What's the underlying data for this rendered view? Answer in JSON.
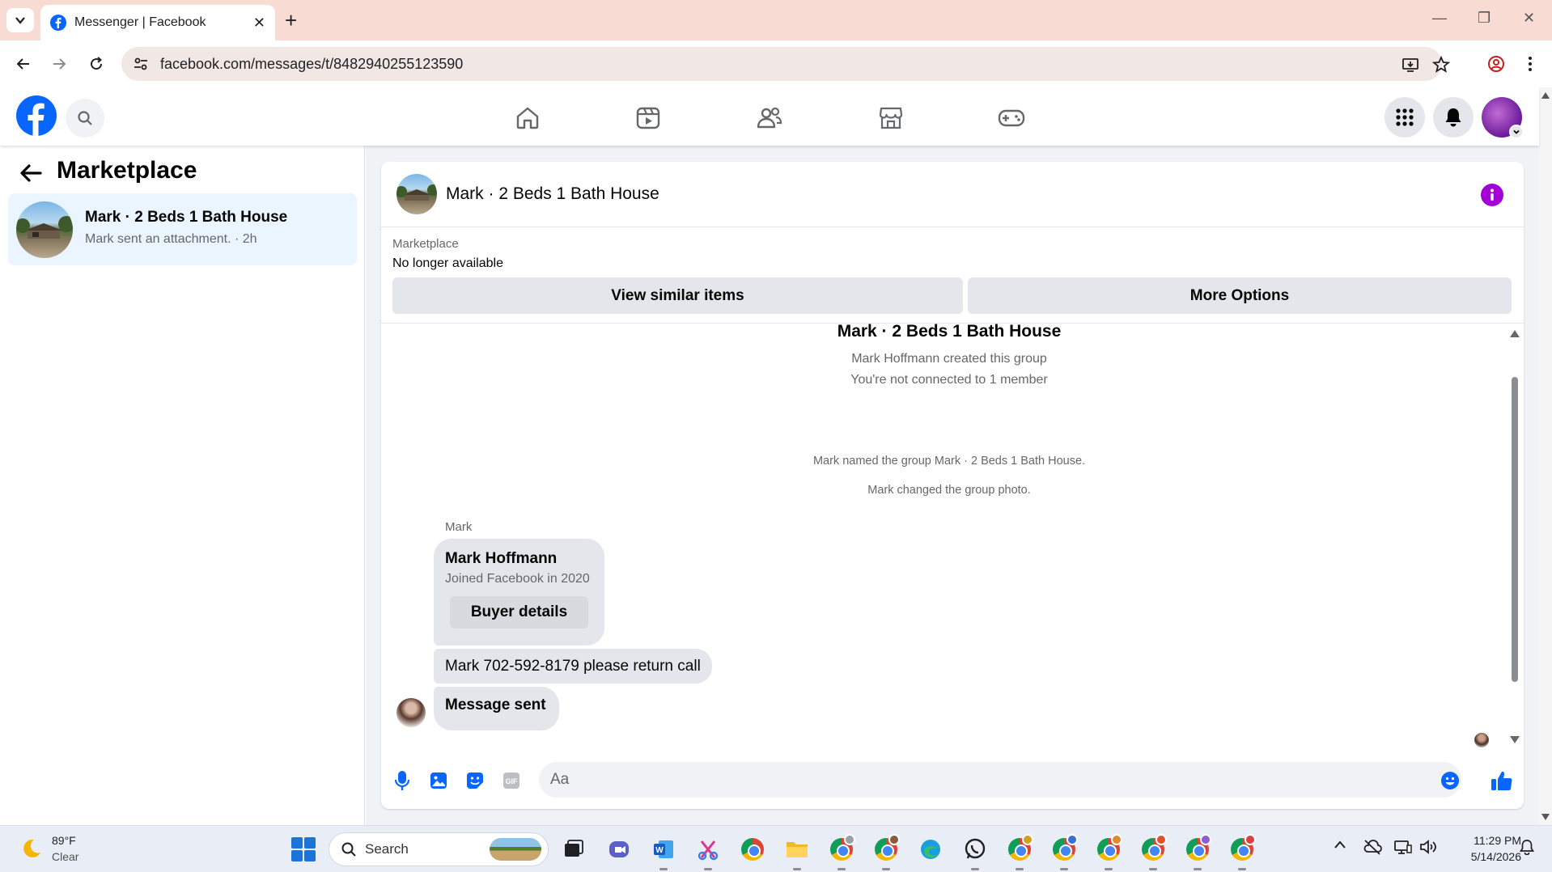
{
  "browser": {
    "tab_title": "Messenger | Facebook",
    "url": "facebook.com/messages/t/8482940255123590"
  },
  "sidebar": {
    "title": "Marketplace",
    "conversation": {
      "name": "Mark · 2 Beds 1 Bath House",
      "preview": "Mark sent an attachment. · 2h"
    }
  },
  "chat": {
    "header_title": "Mark · 2 Beds 1 Bath House",
    "marketplace_label": "Marketplace",
    "listing_status": "No longer available",
    "view_similar_label": "View similar items",
    "more_options_label": "More Options",
    "thread_title": "Mark · 2 Beds 1 Bath House",
    "created_info": "Mark Hoffmann created this group",
    "connection_info": "You're not connected to 1 member",
    "named_event": "Mark named the group Mark · 2 Beds 1 Bath House.",
    "photo_event": "Mark changed the group photo.",
    "sender_label": "Mark",
    "profile_card": {
      "name": "Mark Hoffmann",
      "joined": "Joined Facebook in 2020",
      "button": "Buyer details"
    },
    "messages": [
      "Mark 702-592-8179 please return call",
      "Message sent"
    ],
    "composer_placeholder": "Aa"
  },
  "taskbar": {
    "weather_temp": "89°F",
    "weather_desc": "Clear",
    "search_label": "Search",
    "time": "11:29 PM",
    "date": "5/14/2026"
  },
  "colors": {
    "facebook_blue": "#0866ff",
    "messenger_accent": "#a400d8",
    "selected_conversation": "#ebf5ff",
    "tab_strip": "#f8dcd3"
  }
}
